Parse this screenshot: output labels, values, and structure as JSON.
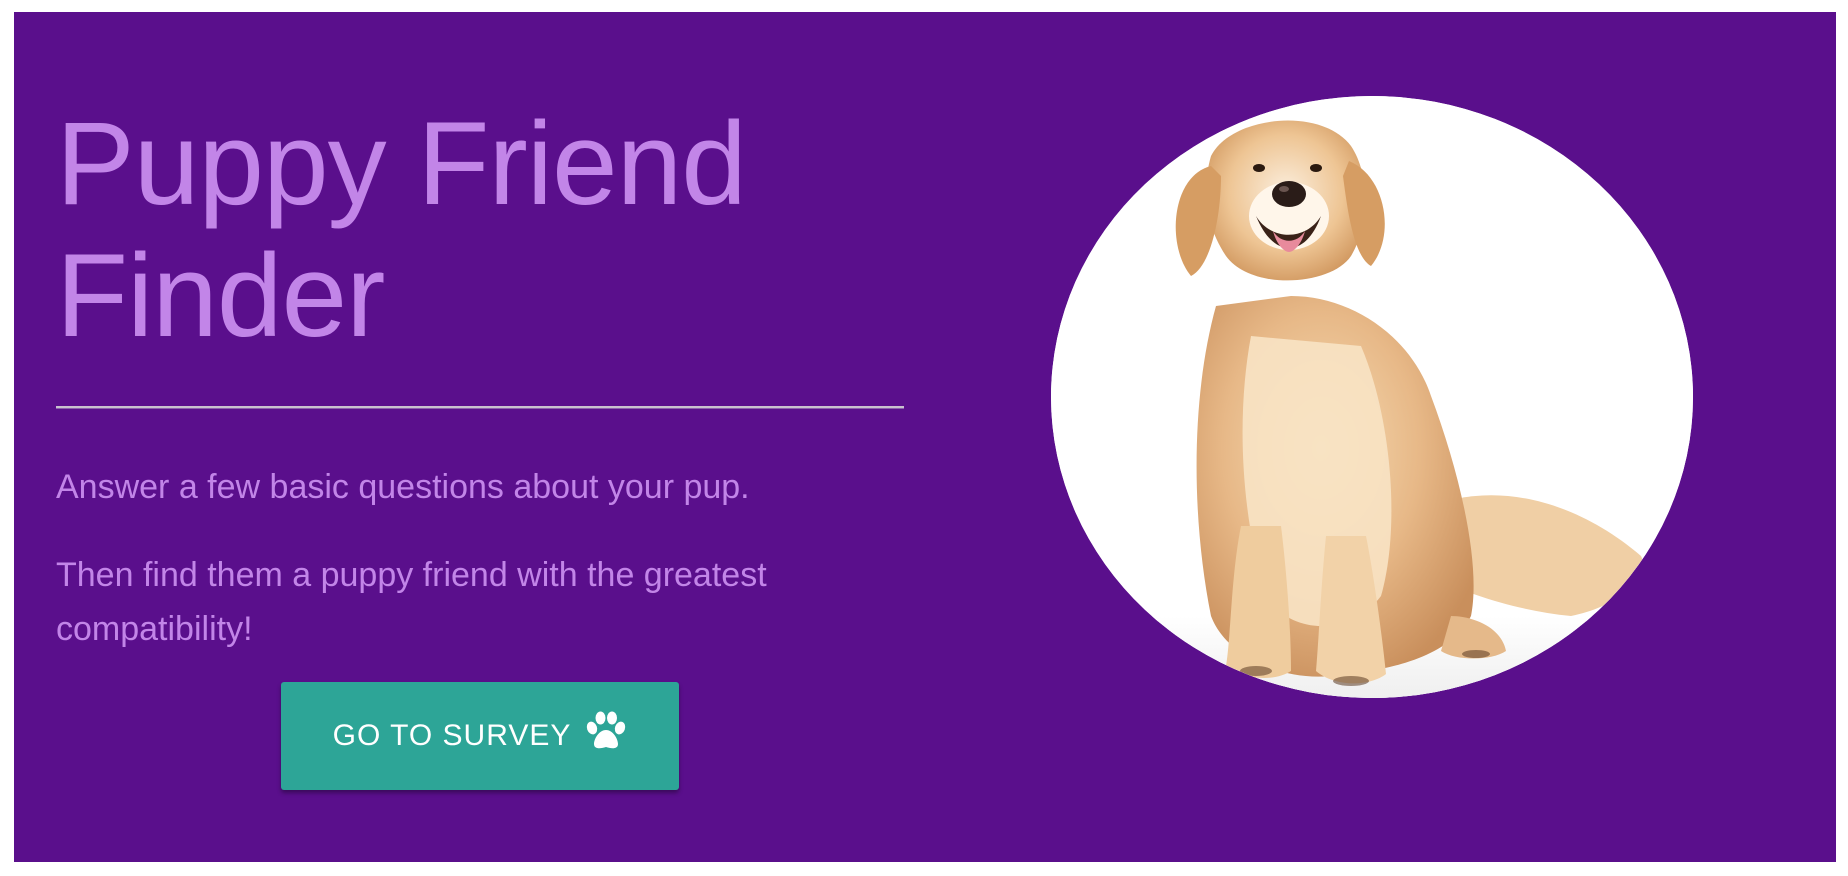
{
  "hero": {
    "background_color": "#5a0f8c",
    "title": "Puppy Friend Finder",
    "title_color": "#c285e8",
    "intro": "Answer a few basic questions about your pup.",
    "tagline": "Then find them a puppy friend with the greatest compatibility!",
    "button": {
      "label": "GO TO SURVEY",
      "icon": "paw-icon",
      "color": "#2da597"
    },
    "image": {
      "subject": "golden-retriever-photo",
      "frame": "circle"
    }
  }
}
